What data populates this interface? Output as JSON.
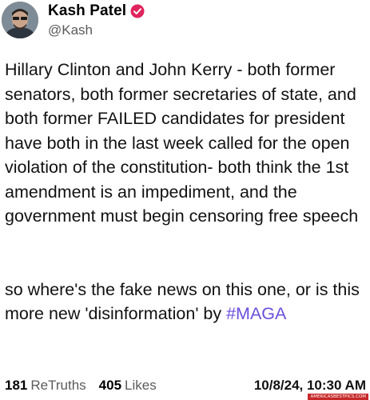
{
  "post": {
    "author": {
      "name": "Kash Patel",
      "handle": "@Kash",
      "verified": true
    },
    "paragraph1": "Hillary Clinton and John Kerry - both former senators, both former secretaries of state, and both former FAILED candidates for president\nhave both in the last week called for the open violation of the constitution- both think the 1st amendment is an impediment, and the government must begin censoring free speech",
    "paragraph2_text": "so where's the fake news on this one, or is this more new 'disinformation' by ",
    "hashtag": "#MAGA",
    "retruths_count": "181",
    "retruths_label": "ReTruths",
    "likes_count": "405",
    "likes_label": "Likes",
    "timestamp": "10/8/24, 10:30 AM"
  },
  "watermark": "AMERICASBESTPICS.COM",
  "colors": {
    "hashtag": "#6b4ddc",
    "verified_badge": "#e0245e"
  },
  "icons": {
    "verified": "verified-badge-icon"
  }
}
